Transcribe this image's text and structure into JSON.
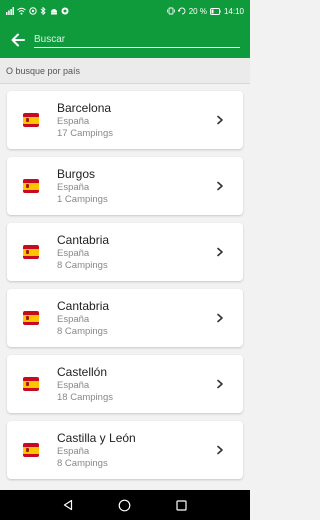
{
  "status_bar": {
    "time": "14:10",
    "battery": "20 %"
  },
  "search": {
    "placeholder": "Buscar"
  },
  "section": {
    "label": "O busque por país"
  },
  "items": [
    {
      "title": "Barcelona",
      "country": "España",
      "count": "17 Campings"
    },
    {
      "title": "Burgos",
      "country": "España",
      "count": "1 Campings"
    },
    {
      "title": "Cantabria",
      "country": "España",
      "count": "8 Campings"
    },
    {
      "title": "Cantabria",
      "country": "España",
      "count": "8 Campings"
    },
    {
      "title": "Castellón",
      "country": "España",
      "count": "18 Campings"
    },
    {
      "title": "Castilla y León",
      "country": "España",
      "count": "8 Campings"
    }
  ],
  "colors": {
    "primary": "#0f9a3c",
    "background": "#f2f2f2"
  }
}
